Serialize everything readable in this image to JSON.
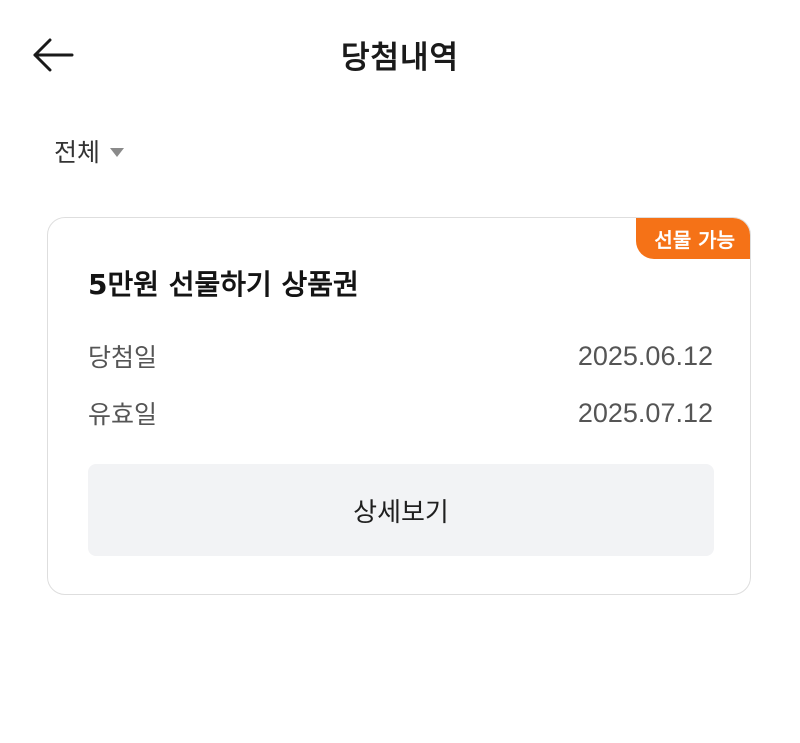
{
  "header": {
    "title": "당첨내역",
    "back_icon": "arrow-left-icon"
  },
  "filter": {
    "label": "전체",
    "icon": "caret-down-icon"
  },
  "card": {
    "badge": "선물 가능",
    "title": "5만원 선물하기 상품권",
    "rows": [
      {
        "label": "당첨일",
        "value": "2025.06.12"
      },
      {
        "label": "유효일",
        "value": "2025.07.12"
      }
    ],
    "detail_button": "상세보기"
  },
  "colors": {
    "badge_bg": "#f57217",
    "button_bg": "#f2f3f5",
    "card_border": "#dedede"
  }
}
